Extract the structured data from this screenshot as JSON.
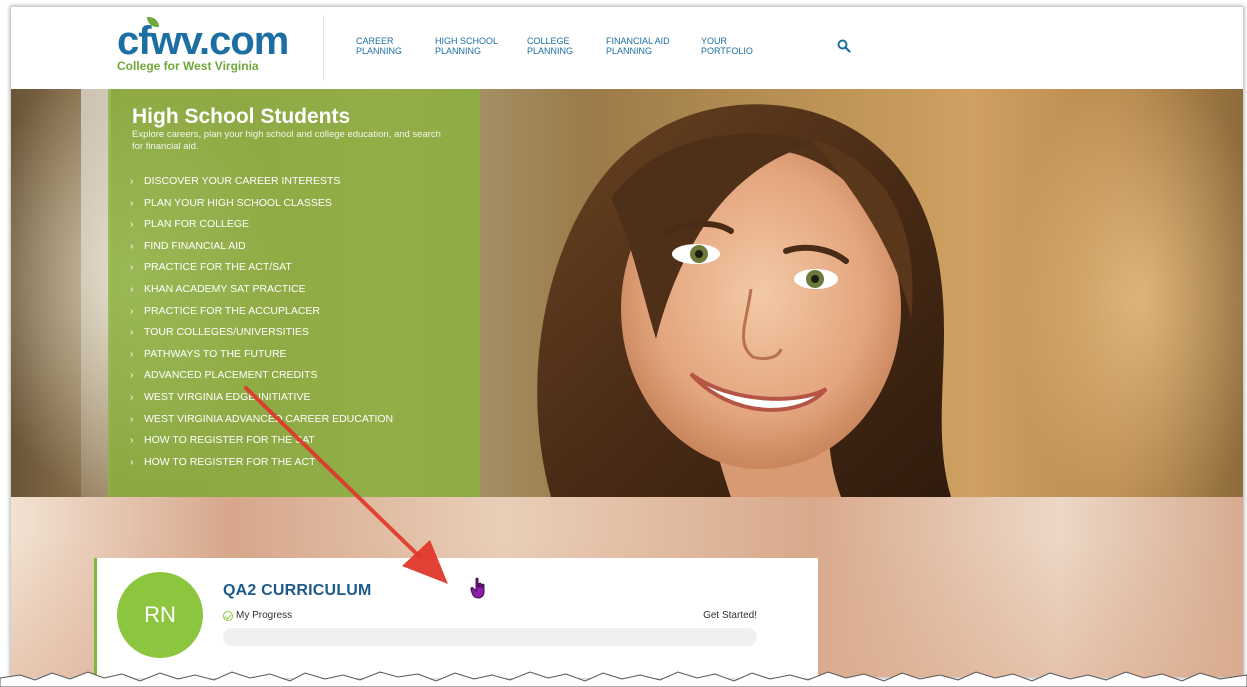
{
  "logo": {
    "wordmark": "cfwv.com",
    "tagline": "College for West Virginia"
  },
  "nav": [
    {
      "label": "CAREER\nPLANNING"
    },
    {
      "label": "HIGH SCHOOL\nPLANNING"
    },
    {
      "label": "COLLEGE\nPLANNING"
    },
    {
      "label": "FINANCIAL AID\nPLANNING"
    },
    {
      "label": "YOUR\nPORTFOLIO"
    }
  ],
  "search": {
    "icon": "search-icon"
  },
  "hero": {
    "title": "High School Students",
    "subtitle": "Explore careers, plan your high school and college education, and search for financial aid.",
    "links": [
      "DISCOVER YOUR CAREER INTERESTS",
      "PLAN YOUR HIGH SCHOOL CLASSES",
      "PLAN FOR COLLEGE",
      "FIND FINANCIAL AID",
      "PRACTICE FOR THE ACT/SAT",
      "KHAN ACADEMY SAT PRACTICE",
      "PRACTICE FOR THE ACCUPLACER",
      "TOUR COLLEGES/UNIVERSITIES",
      "PATHWAYS TO THE FUTURE",
      "ADVANCED PLACEMENT CREDITS",
      "WEST VIRGINIA EDGE INITIATIVE",
      "WEST VIRGINIA ADVANCED CAREER EDUCATION",
      "HOW TO REGISTER FOR THE SAT",
      "HOW TO REGISTER FOR THE ACT"
    ]
  },
  "card": {
    "avatar_initials": "RN",
    "title": "QA2 CURRICULUM",
    "progress_label": "My Progress",
    "cta": "Get Started!",
    "progress_fraction": 0
  },
  "colors": {
    "brand_blue": "#1d6fa3",
    "brand_green": "#8cc63f",
    "annotation_red": "#e0382b"
  }
}
